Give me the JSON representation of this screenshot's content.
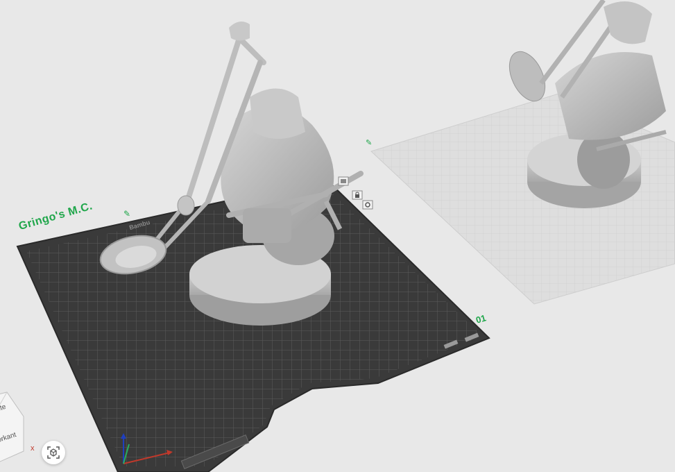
{
  "plate": {
    "name": "Gringo's M.C.",
    "number": "01",
    "logo": "Bambu"
  },
  "icons": {
    "edit_plate_name": "pencil-icon",
    "fit_view": "fit-view-icon",
    "lock_plate": "lock-icon",
    "plate_settings": "settings-icon"
  },
  "axes": {
    "x_label": "x"
  },
  "orientation_cube": {
    "face_top": "ite",
    "face_front": "orkant"
  },
  "colors": {
    "background": "#e8e8e8",
    "active_plate": "#3a3a3a",
    "inactive_plate": "#dcdcdc",
    "accent": "#1fa64a",
    "model": "#b8b8b8"
  }
}
